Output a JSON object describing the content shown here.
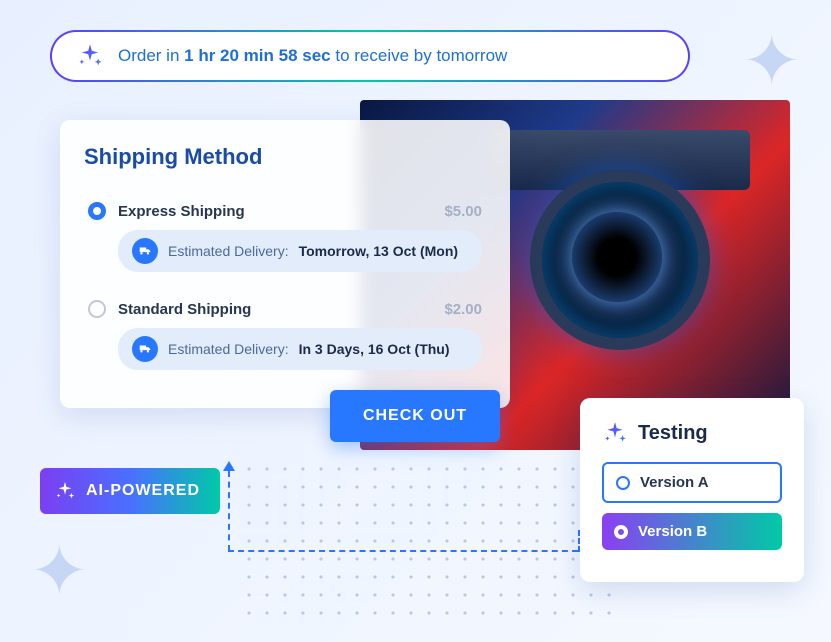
{
  "banner": {
    "prefix": "Order in ",
    "countdown": "1 hr 20 min 58 sec",
    "suffix": " to receive by tomorrow"
  },
  "shipping": {
    "title": "Shipping Method",
    "options": [
      {
        "name": "Express Shipping",
        "price": "$5.00",
        "selected": true,
        "estimate_label": "Estimated Delivery: ",
        "estimate_value": "Tomorrow, 13 Oct (Mon)"
      },
      {
        "name": "Standard Shipping",
        "price": "$2.00",
        "selected": false,
        "estimate_label": "Estimated Delivery: ",
        "estimate_value": "In 3 Days, 16 Oct (Thu)"
      }
    ]
  },
  "checkout_label": "CHECK OUT",
  "ai_badge": "AI-POWERED",
  "testing": {
    "title": "Testing",
    "options": [
      {
        "label": "Version A"
      },
      {
        "label": "Version B"
      }
    ]
  }
}
